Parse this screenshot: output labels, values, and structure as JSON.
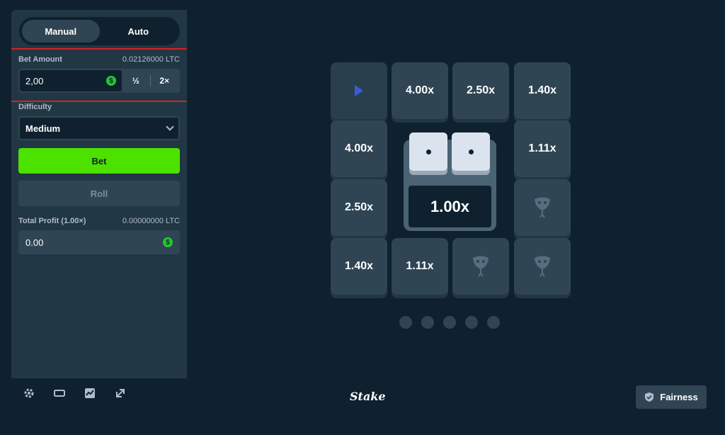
{
  "tabs": [
    {
      "label": "Manual"
    },
    {
      "label": "Auto"
    }
  ],
  "bet": {
    "label": "Bet Amount",
    "ltc_value": "0.02126000 LTC",
    "value": "2,00",
    "half_label": "½",
    "double_label": "2×"
  },
  "difficulty": {
    "label": "Difficulty",
    "selected": "Medium"
  },
  "actions": {
    "bet_label": "Bet",
    "roll_label": "Roll"
  },
  "profit": {
    "label": "Total Profit (1.00×)",
    "ltc_value": "0.00000000 LTC",
    "value": "0.00"
  },
  "board": {
    "top": [
      "4.00x",
      "2.50x",
      "1.40x"
    ],
    "left": [
      "4.00x",
      "2.50x",
      "1.40x"
    ],
    "right": [
      "1.11x"
    ],
    "bottom": [
      "1.11x"
    ],
    "current_multiplier": "1.00x",
    "dice": [
      1,
      1
    ]
  },
  "footer": {
    "brand": "Stake",
    "fairness_label": "Fairness"
  },
  "colors": {
    "accent_green": "#4de100",
    "panel": "#213743",
    "tile": "#2f4553",
    "background": "#0f212e",
    "highlight": "#e11d26"
  }
}
